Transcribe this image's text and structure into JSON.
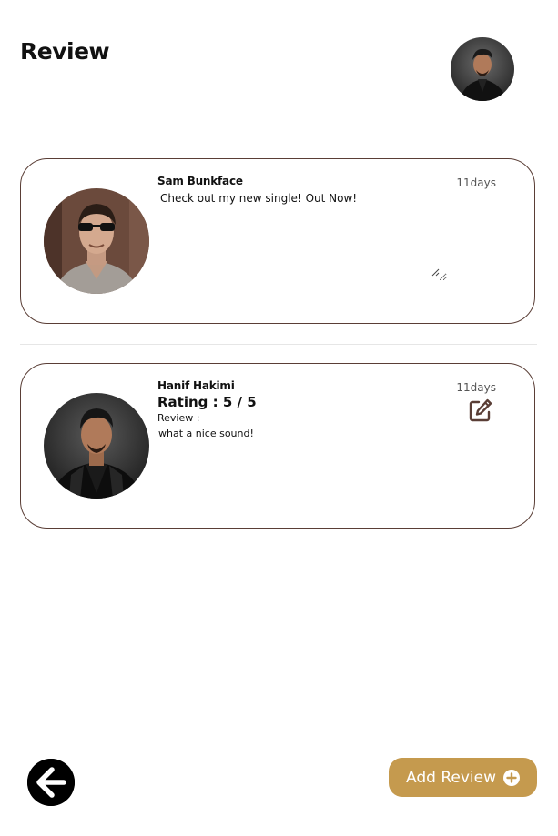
{
  "header": {
    "title": "Review"
  },
  "reviews": [
    {
      "author": "Sam Bunkface",
      "time": "11days",
      "text": "Check out my new single! Out Now!"
    },
    {
      "author": "Hanif Hakimi",
      "time": "11days",
      "rating": "Rating : 5 / 5",
      "review_label": "Review :",
      "text": "what a nice sound!"
    }
  ],
  "footer": {
    "add_review_label": "Add Review"
  },
  "icons": {
    "edit": "edit-icon",
    "back": "arrow-left-icon",
    "add": "plus-circle-icon"
  },
  "colors": {
    "accent": "#c59a4e",
    "card_border": "#5a3e36"
  }
}
